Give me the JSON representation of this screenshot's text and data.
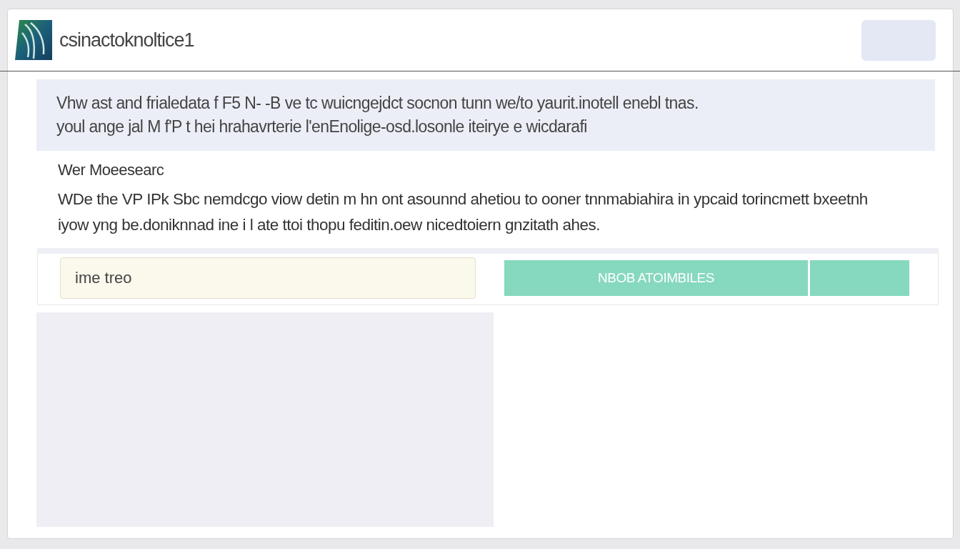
{
  "header": {
    "title": "csinactoknoltice1",
    "button": {
      "kind": "blank"
    }
  },
  "banner": {
    "lines": [
      "Vhw ast and frialedata f F5 N- -B ve tc wuicngejdct socnon tunn we/to yaurit.inotell enebl tnas.",
      "youl ange jal M f'P t hei hrahavrterie l'enEnolige-osd.losonle iteirye e wicdarafi"
    ]
  },
  "section": {
    "heading": "Wer Moeesearc",
    "paragraph": "WDe the VP IPk Sbc nemdcgo viow detin m hn ont asounnd ahetiou to ooner tnnmabiahira in ypcaid torincmett bxeetnh iyow yng be.doniknnad ine i l ate ttoi thopu feditin.oew nicedtoiern gnzitath ahes."
  },
  "form": {
    "field": {
      "value": "ime treo"
    },
    "buttons": [
      {
        "label": "NBOB ATOIMBILES"
      },
      {
        "kind": "blank"
      }
    ]
  },
  "panel": {
    "kind": "blank"
  }
}
